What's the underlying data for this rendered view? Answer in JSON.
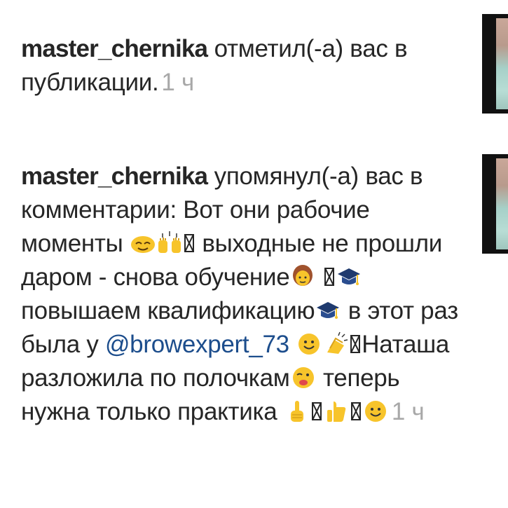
{
  "notifications": [
    {
      "username": "master_chernika",
      "text": " отметил(-а) вас в публикации.",
      "time": "1 ч"
    },
    {
      "username": "master_chernika",
      "segments": {
        "s1": " упомянул(-а) вас в комментарии: Вот они рабочие моменты ",
        "s2": " выходные не прошли даром - снова обучение",
        "s3": "повышаем квалификацию",
        "s4": " в этот раз была у ",
        "mention": "@browexpert_73",
        "s5": "Наташа разложила по полочкам",
        "s6": " теперь нужна только практика "
      },
      "time": "1 ч"
    }
  ],
  "emoji_names": {
    "smile": "smiling-face-icon",
    "raised_hands": "raised-hands-icon",
    "woman": "woman-icon",
    "graduation_cap": "graduation-cap-icon",
    "clapping": "clapping-hands-icon",
    "wink": "winking-tongue-face-icon",
    "point_up": "index-pointing-up-icon",
    "thumbs_up": "thumbs-up-icon",
    "missing_glyph": "missing-glyph-icon"
  },
  "colors": {
    "text": "#262626",
    "time": "#a8a8a8",
    "mention": "#1c4d8c",
    "emoji_yellow": "#f7c42b"
  }
}
